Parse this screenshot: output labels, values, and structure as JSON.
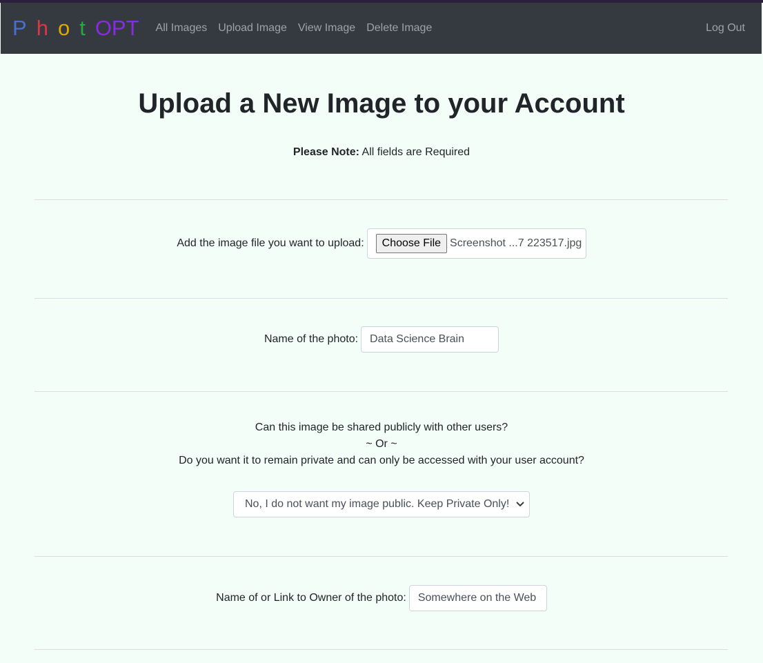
{
  "navbar": {
    "brand": {
      "letters": [
        {
          "char": "P",
          "color": "#4b6fd0"
        },
        {
          "char": "h",
          "color": "#dc3545"
        },
        {
          "char": "o",
          "color": "#e0a800"
        },
        {
          "char": "t",
          "color": "#28a745"
        },
        {
          "char": "OPT",
          "color": "#8a2be2"
        }
      ]
    },
    "links": [
      "All Images",
      "Upload Image",
      "View Image",
      "Delete Image"
    ],
    "logout": "Log Out"
  },
  "page": {
    "title": "Upload a New Image to your Account",
    "note_bold": "Please Note:",
    "note_text": " All fields are Required"
  },
  "form": {
    "file_label": "Add the image file you want to upload:",
    "choose_file": "Choose File",
    "file_name": "Screenshot ...7 223517.jpg",
    "photo_name_label": "Name of the photo:",
    "photo_name_value": "Data Science Brain",
    "share_question_1": "Can this image be shared publicly with other users?",
    "share_question_or": "~ Or ~",
    "share_question_2": "Do you want it to remain private and can only be accessed with your user account?",
    "share_selected": "No, I do not want my image public. Keep Private Only!",
    "owner_label": "Name of or Link to Owner of the photo:",
    "owner_value": "Somewhere on the Web"
  },
  "icons": {
    "select_arrow": "chevron-down-icon"
  }
}
